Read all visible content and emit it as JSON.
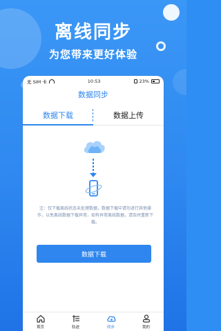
{
  "promo": {
    "headline": "离线同步",
    "subline": "为您带来更好体验"
  },
  "statusbar": {
    "carrier": "无 SIM 卡",
    "time": "10:53",
    "battery": "23%"
  },
  "screen": {
    "title": "数据同步",
    "tabs": [
      {
        "label": "数据下载",
        "active": true
      },
      {
        "label": "数据上传",
        "active": false
      }
    ],
    "notice": "注：仅下载离线状态未处理数据，数据下载中请勿进行其他操作，以免离线数据下载异常，如有异常离线数据，请及时重新下载。",
    "button_label": "数据下载"
  },
  "tabbar": {
    "items": [
      {
        "label": "首页",
        "icon": "home-icon"
      },
      {
        "label": "轨迹",
        "icon": "track-icon"
      },
      {
        "label": "同步",
        "icon": "sync-cloud-icon",
        "active": true
      },
      {
        "label": "我的",
        "icon": "profile-icon"
      }
    ]
  },
  "colors": {
    "accent": "#2e86ee",
    "background": "#2f8ef3"
  }
}
